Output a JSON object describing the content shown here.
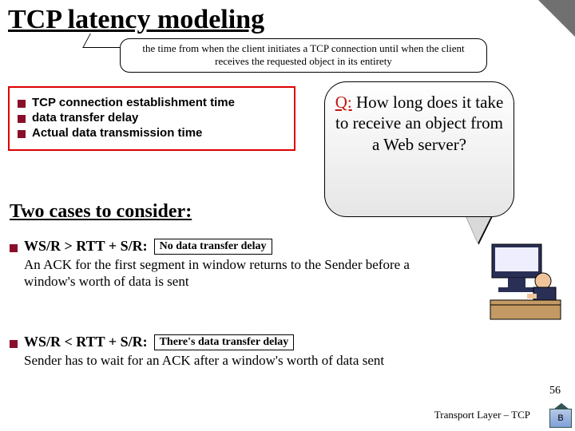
{
  "title": "TCP latency modeling",
  "definition": "the time from when the client initiates a TCP connection until when the client receives the requested object in its entirety",
  "bullets": [
    "TCP connection establishment time",
    "data transfer delay",
    "Actual data transmission time"
  ],
  "subhead": "Two cases to consider:",
  "cases": [
    {
      "label": "WS/R > RTT + S/R:",
      "tag": "No data transfer delay",
      "body": "An ACK for the first segment in window returns to the Sender before a window's worth of data is sent"
    },
    {
      "label": "WS/R < RTT + S/R:",
      "tag": "There's data transfer delay",
      "body": "Sender has to wait for an ACK after a window's worth of data sent"
    }
  ],
  "bubble": {
    "q": "Q:",
    "text": "How long does it take to receive an object from a Web server?"
  },
  "footer": "Transport Layer – TCP",
  "page": "56",
  "home_label": "B"
}
